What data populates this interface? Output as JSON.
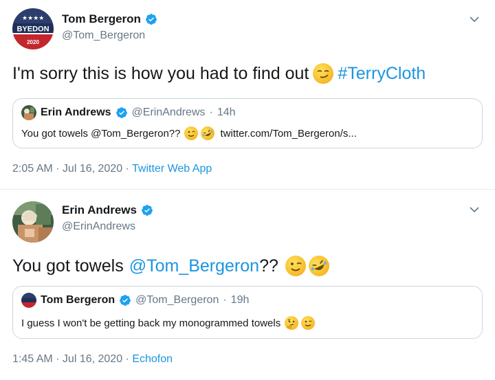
{
  "tweets": [
    {
      "author": {
        "name": "Tom Bergeron",
        "handle": "@Tom_Bergeron",
        "avatar_logo_text": "BYEDON",
        "avatar_logo_year": "2020"
      },
      "text": "I'm sorry this is how you had to find out",
      "emoji": "smirking-face",
      "hashtag": "#TerryCloth",
      "quote": {
        "name": "Erin Andrews",
        "handle": "@ErinAndrews",
        "separator": "·",
        "time": "14h",
        "text": "You got towels @Tom_Bergeron??",
        "emojis": [
          "winking-face",
          "rolling-on-floor-laughing"
        ],
        "link": "twitter.com/Tom_Bergeron/s..."
      },
      "timestamp": "2:05 AM · Jul 16, 2020 ·",
      "source": "Twitter Web App"
    },
    {
      "author": {
        "name": "Erin Andrews",
        "handle": "@ErinAndrews"
      },
      "text_before": "You got towels",
      "mention": "@Tom_Bergeron",
      "text_after": "??",
      "emojis": [
        "winking-face",
        "rolling-on-floor-laughing"
      ],
      "quote": {
        "name": "Tom Bergeron",
        "handle": "@Tom_Bergeron",
        "separator": "·",
        "time": "19h",
        "text": "I guess I won't be getting back my monogrammed towels",
        "emojis": [
          "thinking-face",
          "winking-face"
        ]
      },
      "timestamp": "1:45 AM · Jul 16, 2020 ·",
      "source": "Echofon"
    }
  ],
  "colors": {
    "link_blue": "#1b95e0",
    "verified_blue": "#1da1f2",
    "muted_text": "#657786",
    "border": "#ccd6dd"
  }
}
